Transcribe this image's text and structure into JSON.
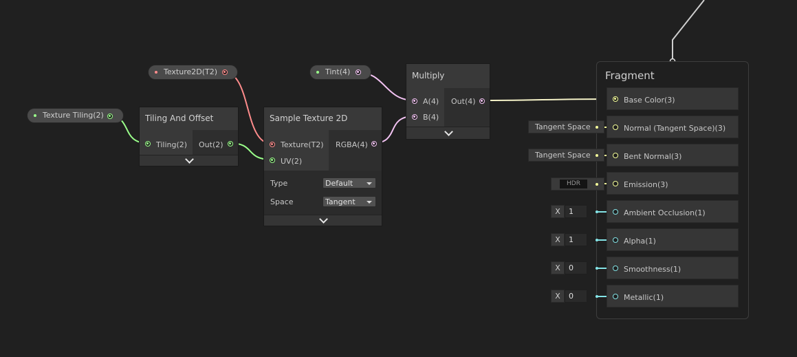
{
  "colors": {
    "texture_port": "#ff8c8c",
    "vector2_port": "#9aff8a",
    "vector4_port": "#f3c3f3",
    "vector3_port": "#f6ff9a",
    "float_port": "#84e4e7"
  },
  "properties": {
    "texture_tiling": "Texture Tiling(2)",
    "texture2d": "Texture2D(T2)",
    "tint": "Tint(4)"
  },
  "tiling_node": {
    "title": "Tiling And Offset",
    "input_tiling": "Tiling(2)",
    "output": "Out(2)"
  },
  "sample_node": {
    "title": "Sample Texture 2D",
    "input_texture": "Texture(T2)",
    "input_uv": "UV(2)",
    "output": "RGBA(4)",
    "type_label": "Type",
    "type_value": "Default",
    "space_label": "Space",
    "space_value": "Tangent"
  },
  "multiply_node": {
    "title": "Multiply",
    "input_a": "A(4)",
    "input_b": "B(4)",
    "output": "Out(4)"
  },
  "fragment": {
    "title": "Fragment",
    "slots": [
      "Base Color(3)",
      "Normal (Tangent Space)(3)",
      "Bent Normal(3)",
      "Emission(3)",
      "Ambient Occlusion(1)",
      "Alpha(1)",
      "Smoothness(1)",
      "Metallic(1)"
    ],
    "normal_default": "Tangent Space",
    "bent_normal_default": "Tangent Space",
    "emission_badge": "HDR",
    "x_label": "X",
    "ao_value": "1",
    "alpha_value": "1",
    "smoothness_value": "0",
    "metallic_value": "0"
  }
}
